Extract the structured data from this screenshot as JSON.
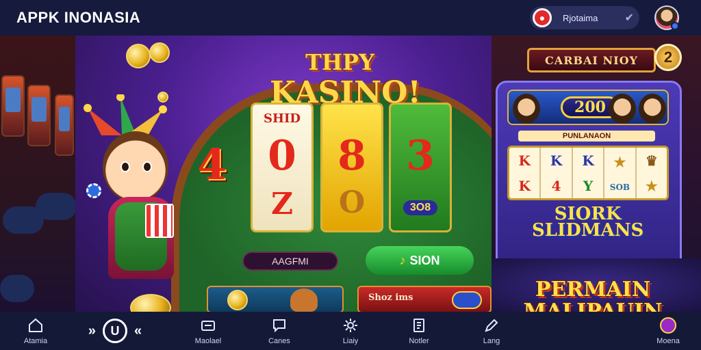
{
  "header": {
    "brand": "APPK INONASIA",
    "user_pill": {
      "name": "Rjotaima",
      "icon": "record-icon"
    },
    "avatar": "user-avatar"
  },
  "hero": {
    "title_top": "THPY",
    "title": "KASINO!",
    "big_number": "4",
    "reels": [
      {
        "top": "SHID",
        "digit": "0",
        "bottom": "Z"
      },
      {
        "top": "",
        "digit": "8",
        "bottom": "O"
      },
      {
        "top": "",
        "digit": "3",
        "bottom": "3O8"
      }
    ],
    "btn_secondary": "AAGFMI",
    "btn_primary": "SION",
    "card_right_label": "Shoz ims"
  },
  "right": {
    "sign": "CARBAI NIOY",
    "badge": "2",
    "jackpot": "200",
    "strip": "PUNLANAON",
    "reel_symbols": [
      [
        "K",
        "K"
      ],
      [
        "K",
        "4"
      ],
      [
        "K",
        "Y"
      ],
      [
        "★",
        "SOB"
      ],
      [
        "♛",
        "★"
      ]
    ],
    "slot_title_1": "SIORK",
    "slot_title_2": "SLIDMANS",
    "promo_1": "PERMAIN",
    "promo_2": "MALIPAUIN"
  },
  "nav": {
    "items": [
      {
        "label": "Atamia",
        "icon": "home-icon"
      },
      {
        "label": "Maolael",
        "icon": "wallet-icon"
      },
      {
        "label": "Canes",
        "icon": "chat-icon"
      },
      {
        "label": "Liaiy",
        "icon": "gear-icon"
      },
      {
        "label": "Notler",
        "icon": "notes-icon"
      },
      {
        "label": "Lang",
        "icon": "edit-icon"
      },
      {
        "label": "Moena",
        "icon": "prize-icon"
      }
    ],
    "center_label": "U"
  }
}
